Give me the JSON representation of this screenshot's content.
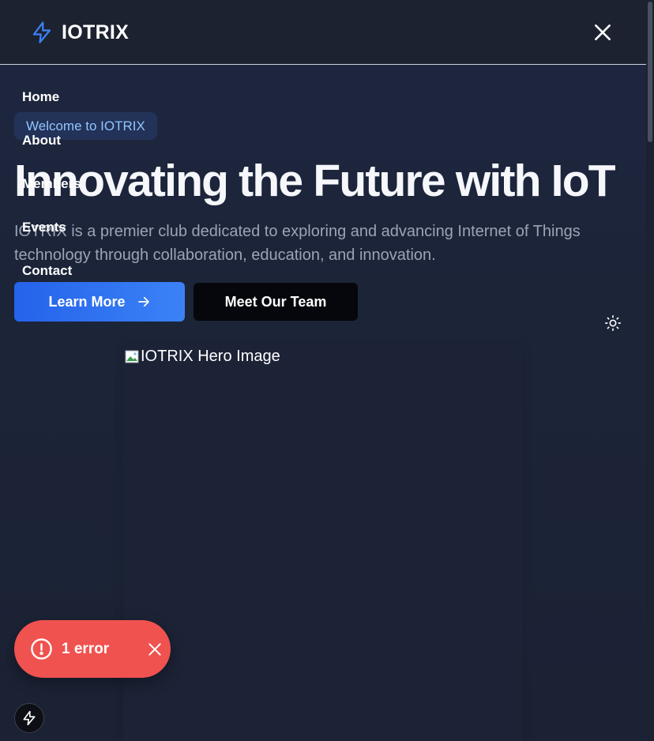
{
  "header": {
    "brand": "IOTRIX",
    "brand_icon": "lightning-bolt-icon",
    "close_icon": "close-icon"
  },
  "nav": {
    "items": [
      {
        "label": "Home"
      },
      {
        "label": "About"
      },
      {
        "label": "Members"
      },
      {
        "label": "Events"
      },
      {
        "label": "Contact"
      }
    ]
  },
  "hero": {
    "badge": "Welcome to IOTRIX",
    "title": "Innovating the Future with IoT",
    "description": "IOTRIX is a premier club dedicated to exploring and advancing Internet of Things technology through collaboration, education, and innovation.",
    "primary_button": "Learn More",
    "secondary_button": "Meet Our Team",
    "image_alt": "IOTRIX Hero Image"
  },
  "theme_toggle_icon": "sun-icon",
  "error_toast": {
    "label": "1 error"
  },
  "colors": {
    "accent": "#3b82f6",
    "badge_text": "#93c5fd",
    "error": "#f0524f",
    "background": "#1e2741"
  }
}
